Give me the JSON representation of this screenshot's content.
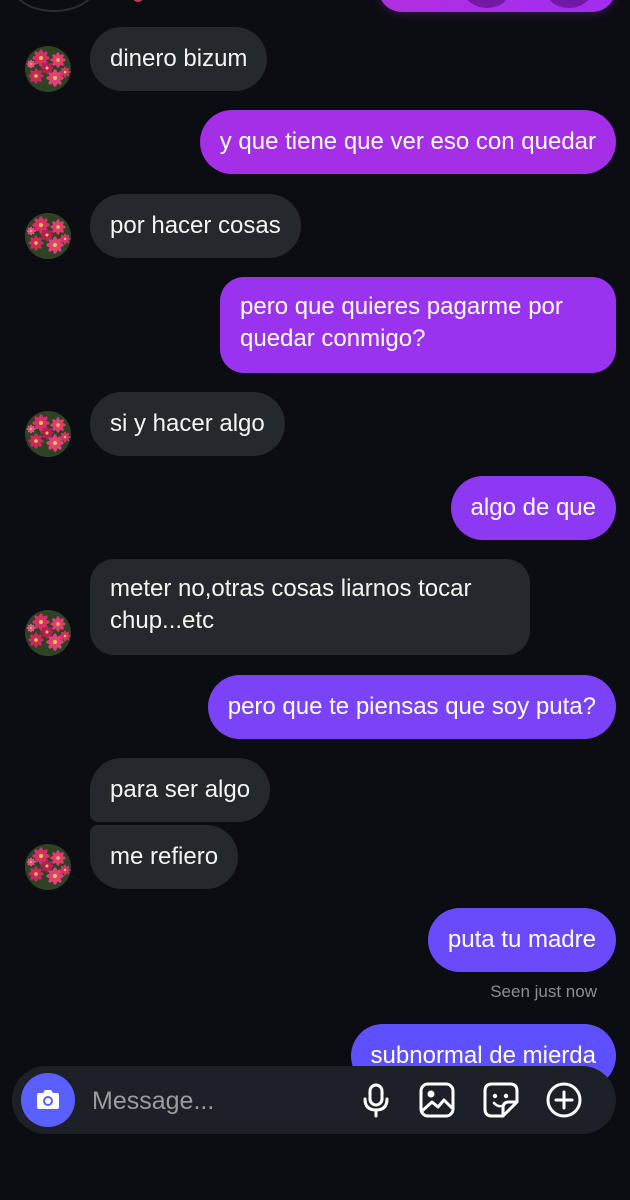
{
  "messages": [
    {
      "side": "in",
      "text": "dinero bizum"
    },
    {
      "side": "out",
      "text": "y que tiene que ver eso con quedar"
    },
    {
      "side": "in",
      "text": "por hacer cosas"
    },
    {
      "side": "out",
      "text": "pero que quieres pagarme por quedar conmigo?"
    },
    {
      "side": "in",
      "text": "si y hacer algo"
    },
    {
      "side": "out",
      "text": "algo de que"
    },
    {
      "side": "in",
      "text": "meter no,otras cosas liarnos tocar chup...etc"
    },
    {
      "side": "out",
      "text": "pero que te piensas que soy puta?"
    },
    {
      "side": "in",
      "text": "para ser algo"
    },
    {
      "side": "in",
      "text": "me refiero"
    },
    {
      "side": "out",
      "text": "puta tu madre"
    },
    {
      "side": "out",
      "text": "subnormal de mierda"
    }
  ],
  "seen_status": "Seen just now",
  "composer": {
    "placeholder": "Message...",
    "icons": [
      "camera-icon",
      "microphone-icon",
      "gallery-icon",
      "sticker-icon",
      "plus-circle-icon"
    ]
  },
  "colors": {
    "background": "#0b0d12",
    "incoming_bubble": "#25282d",
    "outgoing_gradient_top": "#a530e8",
    "outgoing_gradient_bottom": "#5f50ff",
    "camera_button": "#5a60ff",
    "composer": "#1d2026"
  }
}
